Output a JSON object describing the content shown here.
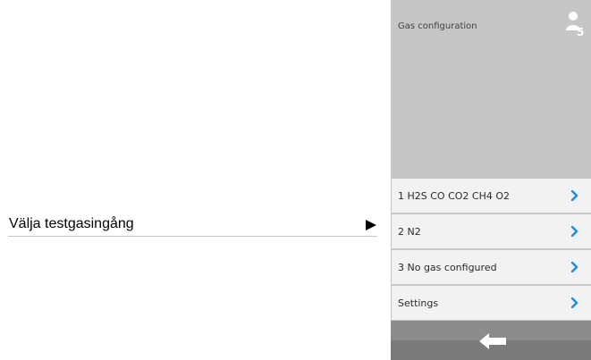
{
  "annotation": {
    "label": "Välja testgasingång",
    "arrow_icon": "right-triangle-icon"
  },
  "screen": {
    "header": {
      "title": "Gas configuration",
      "user_icon": "user-icon",
      "user_level": "5"
    },
    "menu": [
      {
        "label": "1 H2S CO CO2 CH4 O2",
        "icon": "chevron-right-icon"
      },
      {
        "label": "2 N2",
        "icon": "chevron-right-icon"
      },
      {
        "label": "3 No gas configured",
        "icon": "chevron-right-icon"
      },
      {
        "label": "Settings",
        "icon": "chevron-right-icon"
      }
    ],
    "footer": {
      "back_icon": "back-arrow-icon"
    }
  },
  "colors": {
    "screen_background": "#c6c6c6",
    "menu_item_background": "#f2f2f2",
    "chevron_accent": "#1e90e0",
    "footer": "#7a7a7a"
  }
}
